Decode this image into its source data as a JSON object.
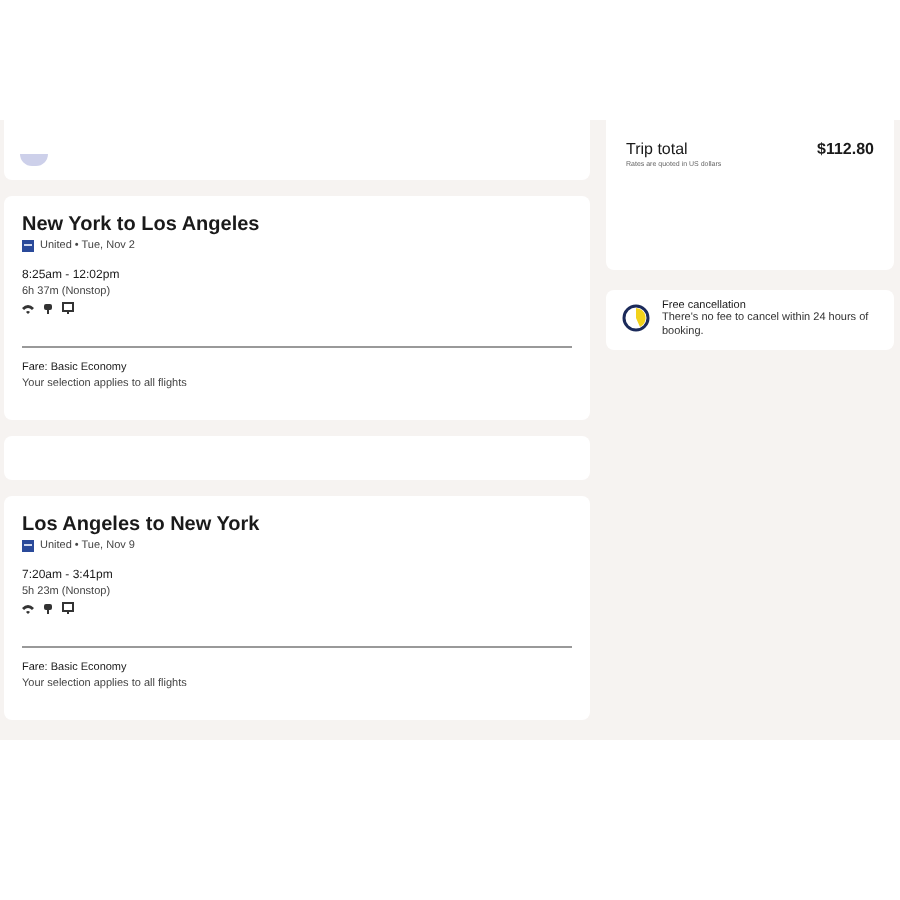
{
  "flights": [
    {
      "title": "New York to Los Angeles",
      "airline": "United • Tue, Nov 2",
      "times": "8:25am - 12:02pm",
      "duration": "6h 37m (Nonstop)",
      "fare": "Fare: Basic Economy",
      "note": "Your selection applies to all flights"
    },
    {
      "title": "Los Angeles to New York",
      "airline": "United • Tue, Nov 9",
      "times": "7:20am - 3:41pm",
      "duration": "5h 23m (Nonstop)",
      "fare": "Fare: Basic Economy",
      "note": "Your selection applies to all flights"
    }
  ],
  "summary": {
    "label": "Trip total",
    "amount": "$112.80",
    "note": "Rates are quoted in US dollars"
  },
  "cancellation": {
    "title": "Free cancellation",
    "text": "There's no fee to cancel within 24 hours of booking."
  }
}
